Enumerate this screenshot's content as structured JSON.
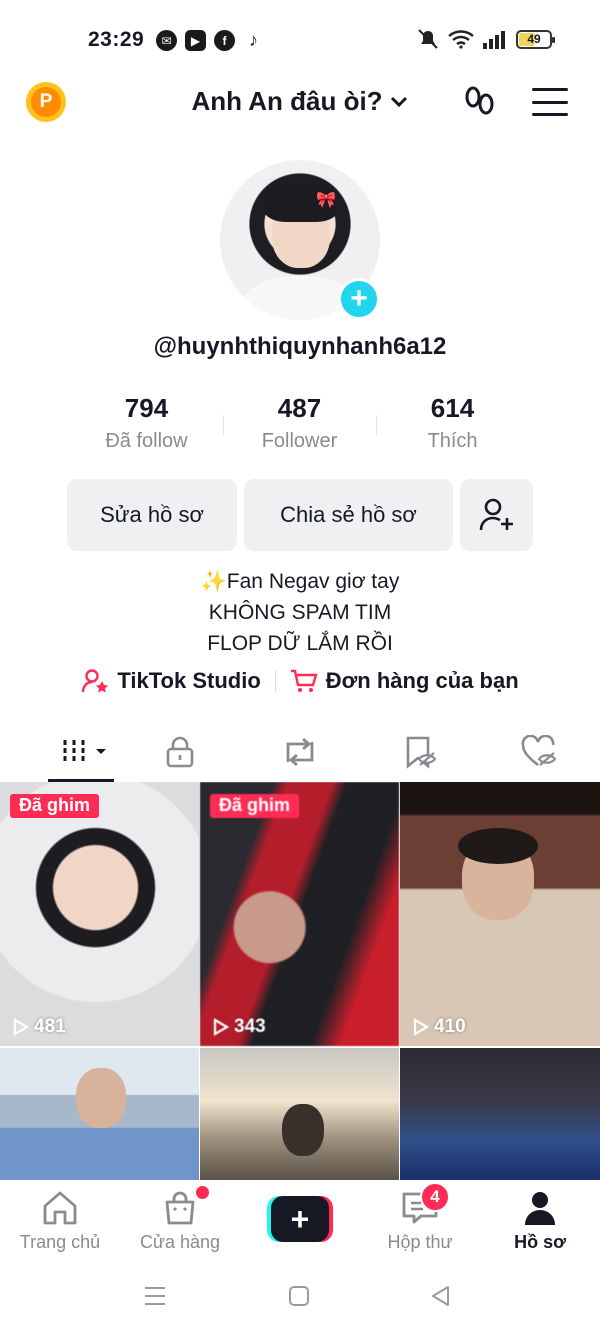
{
  "status_bar": {
    "time": "23:29",
    "battery": "49",
    "battery_level": 0.49
  },
  "header": {
    "title": "Anh An đâu òi?",
    "coin_letter": "P"
  },
  "profile": {
    "username": "@huynhthiquynhanh6a12",
    "stats": [
      {
        "value": "794",
        "label": "Đã follow"
      },
      {
        "value": "487",
        "label": "Follower"
      },
      {
        "value": "614",
        "label": "Thích"
      }
    ]
  },
  "actions": {
    "edit_label": "Sửa hồ sơ",
    "share_label": "Chia sẻ hồ sơ"
  },
  "bio": {
    "line1": "✨Fan Negav giơ tay",
    "line2": "KHÔNG SPAM TIM",
    "line3": "FLOP DỮ LẮM RỒI"
  },
  "links": {
    "studio": "TikTok Studio",
    "orders": "Đơn hàng của bạn"
  },
  "tabs": [
    {
      "name": "videos",
      "icon": "grid-icon"
    },
    {
      "name": "private",
      "icon": "lock-icon"
    },
    {
      "name": "reposts",
      "icon": "repost-icon"
    },
    {
      "name": "favorites",
      "icon": "bookmark-icon"
    },
    {
      "name": "liked",
      "icon": "heart-icon"
    }
  ],
  "videos": [
    {
      "pinned_label": "Đã ghim",
      "views": "481"
    },
    {
      "pinned_label": "Đã ghim",
      "views": "343"
    },
    {
      "views": "410"
    },
    {},
    {},
    {}
  ],
  "bottom_nav": {
    "home": "Trang chủ",
    "shop": "Cửa hàng",
    "inbox": "Hộp thư",
    "inbox_badge": "4",
    "profile": "Hồ sơ"
  },
  "colors": {
    "accent": "#fe2c55",
    "cyan": "#20d5ec",
    "coin": "#ffc21a"
  }
}
